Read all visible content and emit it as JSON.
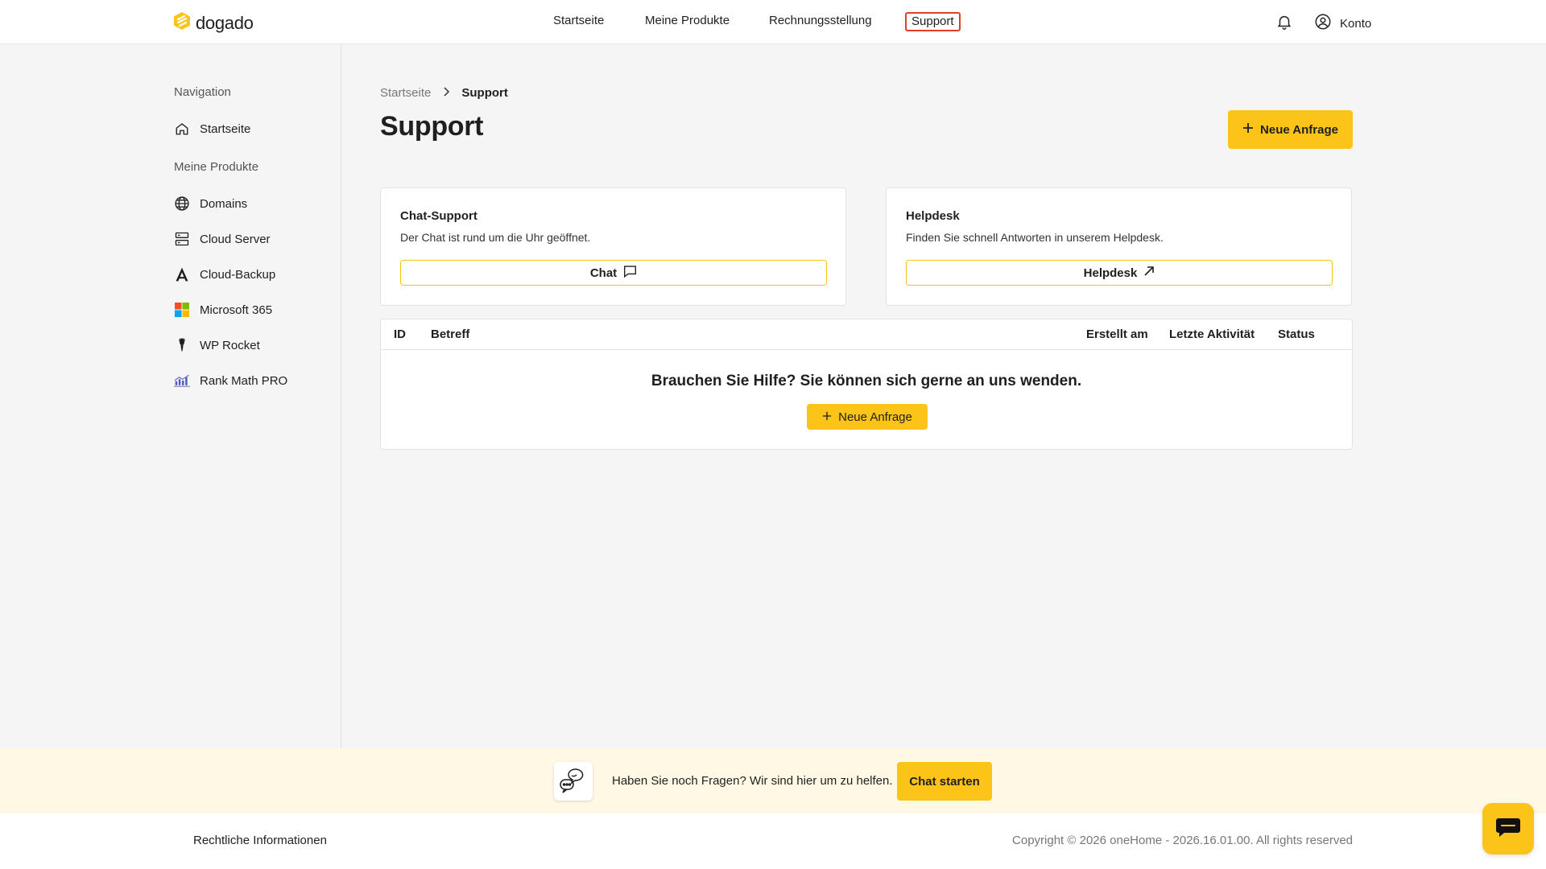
{
  "app": {
    "logo_text": "dogado"
  },
  "topnav": {
    "items": [
      "Startseite",
      "Meine Produkte",
      "Rechnungsstellung",
      "Support"
    ],
    "account_label": "Konto"
  },
  "sidebar": {
    "nav_heading": "Navigation",
    "home_label": "Startseite",
    "products_heading": "Meine Produkte",
    "items": [
      "Domains",
      "Cloud Server",
      "Cloud-Backup",
      "Microsoft 365",
      "WP Rocket",
      "Rank Math PRO"
    ]
  },
  "breadcrumb": [
    "Startseite",
    "Support"
  ],
  "page": {
    "title": "Support",
    "new_request_label": "Neue Anfrage"
  },
  "cards": {
    "chat": {
      "title": "Chat-Support",
      "desc": "Der Chat ist rund um die Uhr geöffnet.",
      "button": "Chat"
    },
    "helpdesk": {
      "title": "Helpdesk",
      "desc": "Finden Sie schnell Antworten in unserem Helpdesk.",
      "button": "Helpdesk"
    }
  },
  "table": {
    "columns": [
      "ID",
      "Betreff",
      "Erstellt am",
      "Letzte Aktivität",
      "Status"
    ],
    "rows": [],
    "empty_message": "Brauchen Sie Hilfe? Sie können sich gerne an uns wenden.",
    "empty_button": "Neue Anfrage"
  },
  "help_band": {
    "text": "Haben Sie noch Fragen? Wir sind hier um zu helfen.",
    "button": "Chat starten"
  },
  "footer": {
    "legal": "Rechtliche Informationen",
    "copyright": "Copyright © 2026 oneHome - 2026.16.01.00. All rights reserved"
  },
  "colors": {
    "accent": "#fcc419",
    "active_outline": "#e0402a"
  }
}
